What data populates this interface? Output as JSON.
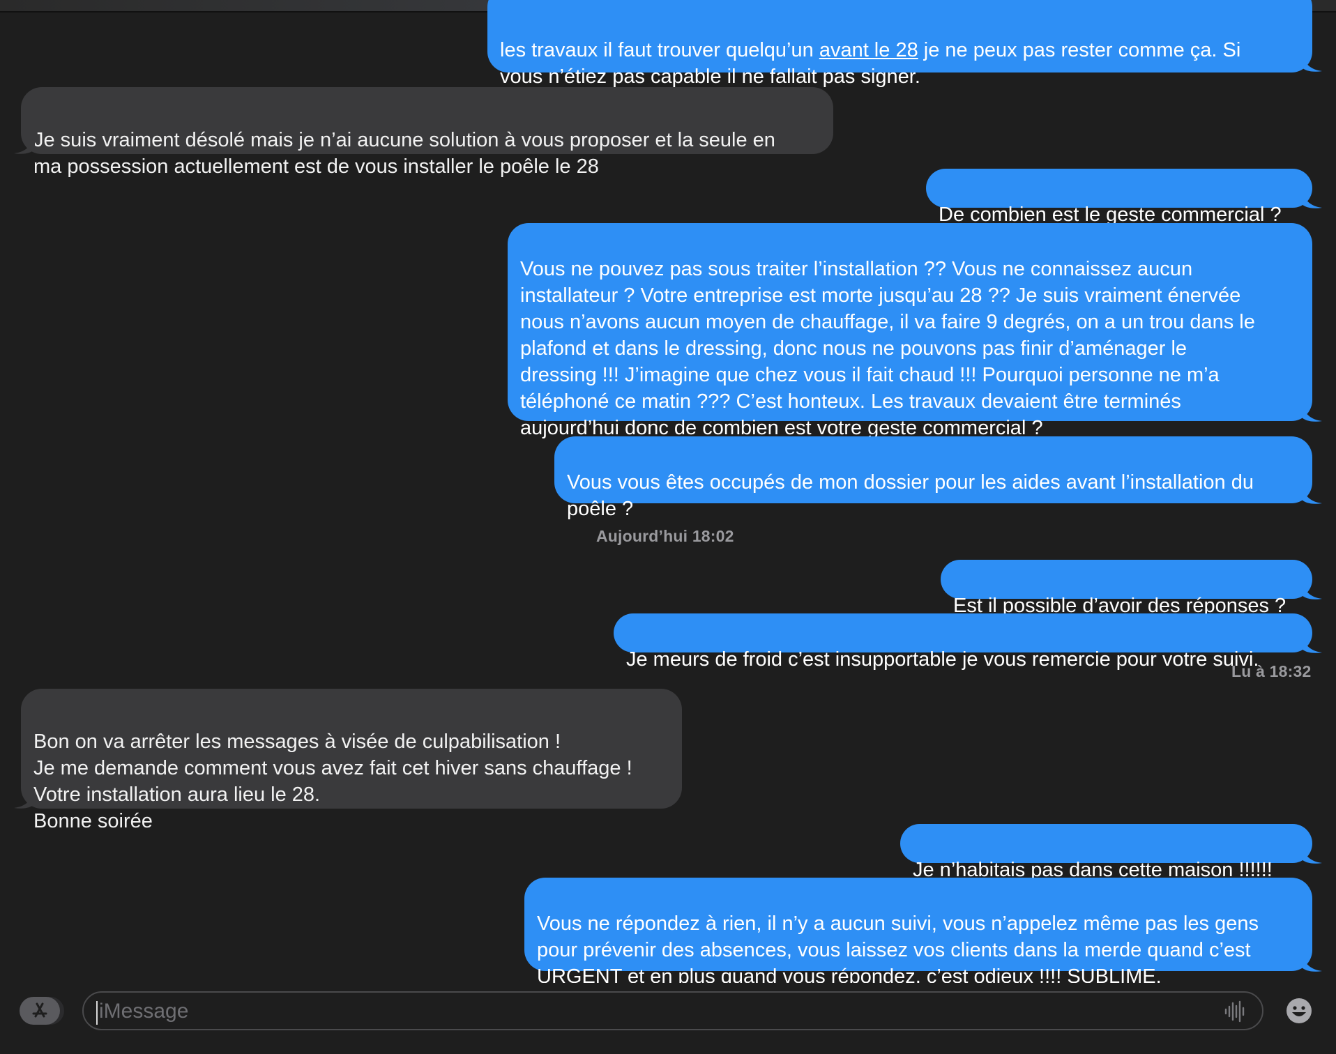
{
  "messages": [
    {
      "dir": "out",
      "text": "les travaux il faut trouver quelqu’un ",
      "link": "avant le 28",
      "text_after": " je ne peux pas rester comme ça. Si\nvous n’étiez pas capable il ne fallait pas signer."
    },
    {
      "dir": "in",
      "text": "Je suis vraiment désolé mais je n’ai aucune solution à vous proposer et la seule en\nma possession actuellement est de vous installer le poêle le 28"
    },
    {
      "dir": "out",
      "text": "De combien est le geste commercial ?"
    },
    {
      "dir": "out",
      "text": "Vous ne pouvez pas sous traiter l’installation ?? Vous ne connaissez aucun\ninstallateur ? Votre entreprise est morte jusqu’au 28 ?? Je suis vraiment énervée\nnous n’avons aucun moyen de chauffage, il va faire 9 degrés, on a un trou dans le\nplafond et dans le dressing, donc nous ne pouvons pas finir d’aménager le\ndressing !!! J’imagine que chez vous il fait chaud !!! Pourquoi personne ne m’a\ntéléphoné ce matin ??? C’est honteux. Les travaux devaient être terminés\naujourd’hui donc de combien est votre geste commercial ?"
    },
    {
      "dir": "out",
      "text": "Vous vous êtes occupés de mon dossier pour les aides avant l’installation du\npoêle ?"
    },
    {
      "dir": "out",
      "text": "Est il possible d’avoir des réponses ?"
    },
    {
      "dir": "out",
      "text": "Je meurs de froid c’est insupportable je vous remercie pour votre suivi."
    },
    {
      "dir": "in",
      "text": "Bon on va arrêter les messages à visée de culpabilisation !\nJe me demande comment vous avez fait cet hiver sans chauffage !\nVotre installation aura lieu le 28.\nBonne soirée"
    },
    {
      "dir": "out",
      "text": "Je n’habitais pas dans cette maison !!!!!!"
    },
    {
      "dir": "out",
      "text": "Vous ne répondez à rien, il n’y a aucun suivi, vous n’appelez même pas les gens\npour prévenir des absences, vous laissez vos clients dans la merde quand c’est\nURGENT et en plus quand vous répondez, c’est odieux !!!! SUBLIME."
    }
  ],
  "timestamps": {
    "today": "Aujourd’hui 18:02",
    "read_receipt": "Lu à 18:32"
  },
  "input": {
    "placeholder": "iMessage",
    "value": ""
  },
  "icons": {
    "apps": "app-store-icon",
    "audio": "waveform-icon",
    "emoji": "emoji-icon"
  },
  "colors": {
    "outgoing_bubble": "#2e8ff5",
    "incoming_bubble": "#3a3a3c",
    "background": "#1e1e1e",
    "timestamp": "#9a9a9e"
  }
}
